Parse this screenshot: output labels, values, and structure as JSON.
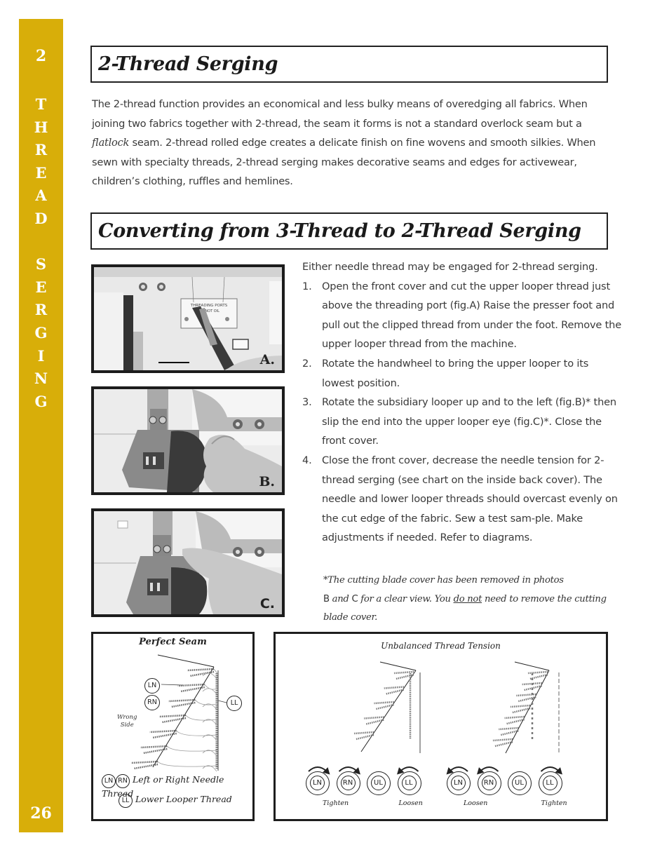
{
  "sidebar": {
    "chapter_number": "2",
    "chapter_title_letters": [
      "T",
      "H",
      "R",
      "E",
      "A",
      "D",
      "",
      "S",
      "E",
      "R",
      "G",
      "I",
      "N",
      "G"
    ],
    "page_number": "26",
    "color": "#d8ae09"
  },
  "section1": {
    "title": "2-Thread Serging",
    "body_parts": [
      "The 2-thread function provides an economical and less bulky means of overedging all fabrics. When joining two fabrics together with 2-thread, the seam it forms is not a standard overlock seam but a ",
      "flatlock",
      " seam. 2-thread rolled edge creates a delicate finish on fine wovens and smooth silkies. When sewn with specialty threads, 2-thread serging makes decorative seams and edges for activewear, children’s clothing, ruffles and hemlines."
    ]
  },
  "section2": {
    "title": "Converting from 3-Thread to 2-Thread Serging",
    "lead": "Either needle thread may be engaged for 2-thread serging.",
    "steps": [
      {
        "num": "1.",
        "text": "Open the front cover and cut the upper looper thread just above the threading port (fig.A) Raise the presser foot and pull out the clipped thread from under the foot. Remove the upper looper thread from the machine."
      },
      {
        "num": "2.",
        "text": "Rotate the handwheel to bring the upper looper to its lowest position."
      },
      {
        "num": "3.",
        "text": "Rotate the subsidiary looper up and to the left (fig.B)* then slip the end into the upper looper eye (fig.C)*. Close the front cover."
      },
      {
        "num": "4.",
        "text": "Close the front cover, decrease the needle tension for 2-thread serging (see chart on the inside back cover). The needle and lower looper threads should overcast evenly on the cut edge of the fabric. Sew a test sam-ple. Make adjustments if needed. Refer to diagrams."
      }
    ],
    "note": {
      "part1": "*The cutting blade cover has been removed in photos",
      "part2_upright": "B",
      "part2": " and ",
      "part2_upright_b": "C",
      "part2_rest": "  for a clear view. You ",
      "underlined": "do not",
      "part3": " need to remove the cutting blade cover."
    },
    "photos": [
      {
        "label": "A.",
        "imprint_text": "THREADING PORTS",
        "imprint_sub": "DO NOT OIL"
      },
      {
        "label": "B."
      },
      {
        "label": "C."
      }
    ]
  },
  "diagram_perfect": {
    "title": "Perfect Seam",
    "callouts": [
      "LN",
      "RN",
      "LL"
    ],
    "side_label_1": "Wrong",
    "side_label_2": "Side",
    "legend": [
      {
        "rings": [
          "LN",
          "RN"
        ],
        "text": "Left or Right Needle Thread"
      },
      {
        "rings": [
          "LL"
        ],
        "text": "Lower Looper Thread"
      }
    ]
  },
  "diagram_unbalanced": {
    "title": "Unbalanced Thread Tension",
    "groups": [
      {
        "dials": [
          {
            "label": "LN",
            "arrow": "clockwise"
          },
          {
            "label": "RN",
            "arrow": "clockwise"
          },
          {
            "label": "UL",
            "arrow": "none"
          },
          {
            "label": "LL",
            "arrow": "counterclockwise"
          }
        ],
        "caption_left": "Tighten",
        "caption_right": "Loosen"
      },
      {
        "dials": [
          {
            "label": "LN",
            "arrow": "counterclockwise"
          },
          {
            "label": "RN",
            "arrow": "counterclockwise"
          },
          {
            "label": "UL",
            "arrow": "none"
          },
          {
            "label": "LL",
            "arrow": "clockwise"
          }
        ],
        "caption_left": "Loosen",
        "caption_right": "Tighten"
      }
    ]
  }
}
